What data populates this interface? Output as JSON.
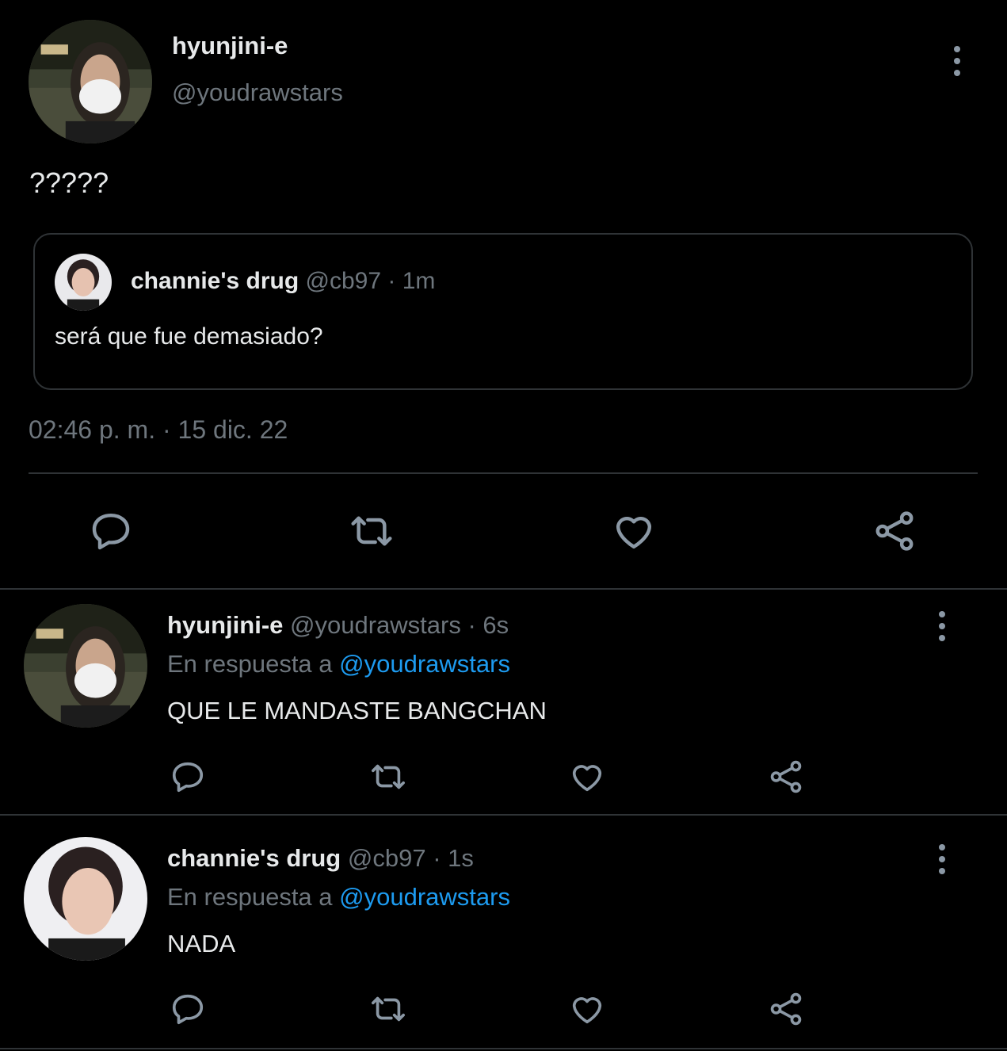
{
  "main_tweet": {
    "display_name": "hyunjini-e",
    "handle": "@youdrawstars",
    "text": "?????",
    "timestamp": "02:46 p. m. · 15 dic. 22",
    "quoted": {
      "display_name": "channie's drug",
      "handle": "@cb97",
      "time": "· 1m",
      "text": "será que fue demasiado?"
    }
  },
  "replies": [
    {
      "display_name": "hyunjini-e",
      "handle": "@youdrawstars",
      "time": "· 6s",
      "reply_prefix": "En respuesta a",
      "reply_to": "@youdrawstars",
      "text": "QUE LE MANDASTE BANGCHAN"
    },
    {
      "display_name": "channie's drug",
      "handle": "@cb97",
      "time": "· 1s",
      "reply_prefix": "En respuesta a",
      "reply_to": "@youdrawstars",
      "text": "NADA"
    }
  ],
  "icons": {
    "reply": "speech-bubble-icon",
    "retweet": "retweet-icon",
    "like": "heart-icon",
    "share": "share-icon",
    "more": "more-vertical-icon"
  },
  "colors": {
    "background": "#000000",
    "text": "#e7e9ea",
    "muted": "#6e767d",
    "link": "#1d9bf0",
    "divider": "#2f3336"
  }
}
